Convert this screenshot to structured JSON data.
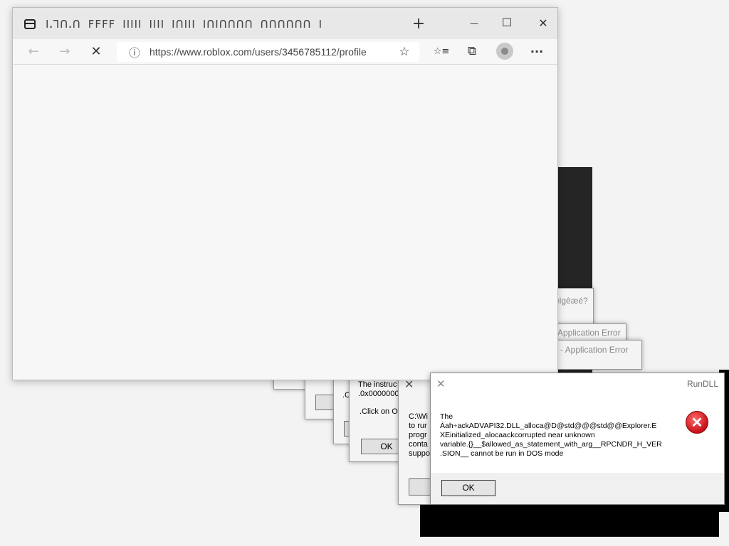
{
  "browser": {
    "tab_title": "ꓲꓸꓶꓵꓸꓵ ꓝꓝꓝꓝ ꓲꓲꓲꓲꓲ ꓲꓲꓲꓲ ꓲꓵꓲꓲꓲ ꓲꓵꓲꓵꓵꓵꓵ ꓵꓵꓵꓵꓵꓵ ꓲ",
    "new_tab": "+",
    "minimize": "—",
    "maximize": "☐",
    "close": "✕",
    "back": "←",
    "forward": "→",
    "stop": "✕",
    "info": "ⓘ",
    "url": "https://www.roblox.com/users/3456785112/profile",
    "favorite": "☆",
    "favorites": "☆≡",
    "collections": "⧉",
    "more": "···"
  },
  "errors": {
    "title_partial_1": "elgêæé?",
    "title_partial_2": "Application Error",
    "title_partial_3": "ke - Application Error",
    "text_instruct_1": "The instruc",
    "text_instruct_2": ".0x0000000",
    "text_instruct_3": ".Click on O",
    "text_c_1": ".C",
    "text_wi_1": "C:\\Wi",
    "text_wi_2": "to rur",
    "text_wi_3": "progr",
    "text_wi_4": "conta",
    "text_wi_5": "suppo",
    "ok": "OK"
  },
  "rundll": {
    "title": "RunDLL",
    "message": "The\nÀah÷ackADVAPI32.DLL_alloca@D@std@@@std@@Explorer.E\nXEinitialized_alocaackcorrupted near unknown\nvariable.{}__$allowed_as_statement_with_arg__RPCNDR_H_VER\n.SION__ cannot be run in DOS mode",
    "ok_label": "OK",
    "close": "✕"
  },
  "colors": {
    "error_red": "#c8101a",
    "button_bg": "#e1e1e1"
  }
}
